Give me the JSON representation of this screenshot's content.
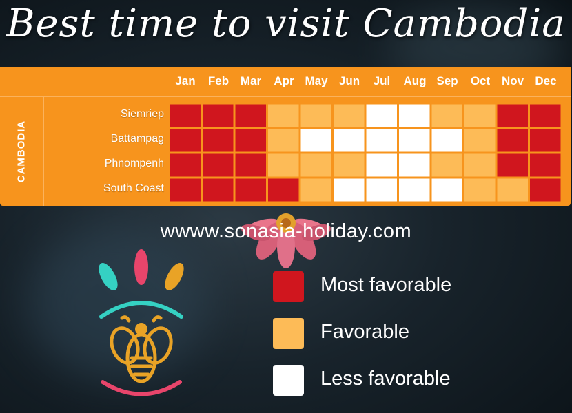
{
  "title": "Best time to visit Cambodia",
  "chart_data": {
    "type": "heatmap",
    "months": [
      "Jan",
      "Feb",
      "Mar",
      "Apr",
      "May",
      "Jun",
      "Jul",
      "Aug",
      "Sep",
      "Oct",
      "Nov",
      "Dec"
    ],
    "country": "CAMBODIA",
    "rows": [
      {
        "label": "Siemriep",
        "values": [
          "most",
          "most",
          "most",
          "fav",
          "fav",
          "fav",
          "less",
          "less",
          "fav",
          "fav",
          "most",
          "most"
        ]
      },
      {
        "label": "Battampag",
        "values": [
          "most",
          "most",
          "most",
          "fav",
          "less",
          "less",
          "less",
          "less",
          "less",
          "fav",
          "most",
          "most"
        ]
      },
      {
        "label": "Phnompenh",
        "values": [
          "most",
          "most",
          "most",
          "fav",
          "fav",
          "fav",
          "less",
          "less",
          "fav",
          "fav",
          "most",
          "most"
        ]
      },
      {
        "label": "South Coast",
        "values": [
          "most",
          "most",
          "most",
          "most",
          "fav",
          "less",
          "less",
          "less",
          "less",
          "fav",
          "fav",
          "most"
        ]
      }
    ],
    "levels": {
      "most": {
        "label": "Most favorable",
        "color": "#d0161e"
      },
      "fav": {
        "label": "Favorable",
        "color": "#fdbb57"
      },
      "less": {
        "label": "Less favorable",
        "color": "#ffffff"
      }
    }
  },
  "website": "wwww.sonasia-holiday.com",
  "legend": [
    {
      "key": "most",
      "label": "Most favorable"
    },
    {
      "key": "fav",
      "label": "Favorable"
    },
    {
      "key": "less",
      "label": "Less favorable"
    }
  ],
  "colors": {
    "chart_background": "#f7941d",
    "logo_teal": "#35d1c3",
    "logo_pink": "#e8456b",
    "logo_gold": "#e9a326"
  },
  "logo_icon": "bee-logo-icon"
}
